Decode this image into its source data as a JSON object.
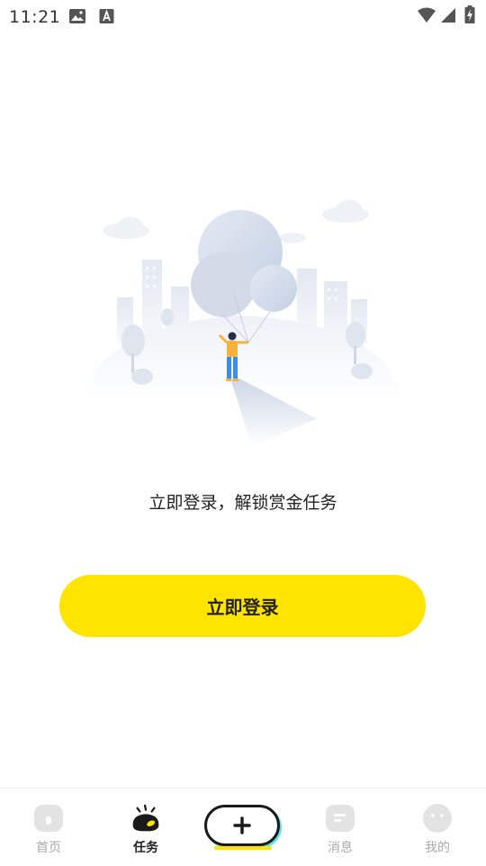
{
  "status": {
    "time": "11:21",
    "left_icons": [
      "image-icon",
      "text-a-icon"
    ],
    "right_icons": [
      "wifi-icon",
      "signal-icon",
      "battery-charging-icon"
    ]
  },
  "main": {
    "tagline": "立即登录，解锁赏金任务",
    "login_label": "立即登录",
    "accent_color": "#FFE400"
  },
  "tabbar": {
    "tabs": [
      {
        "label": "首页",
        "icon": "home-icon",
        "active": false
      },
      {
        "label": "任务",
        "icon": "task-icon",
        "active": true
      },
      {
        "label": "",
        "icon": "plus-icon",
        "active": false
      },
      {
        "label": "消息",
        "icon": "message-icon",
        "active": false
      },
      {
        "label": "我的",
        "icon": "profile-icon",
        "active": false
      }
    ]
  }
}
